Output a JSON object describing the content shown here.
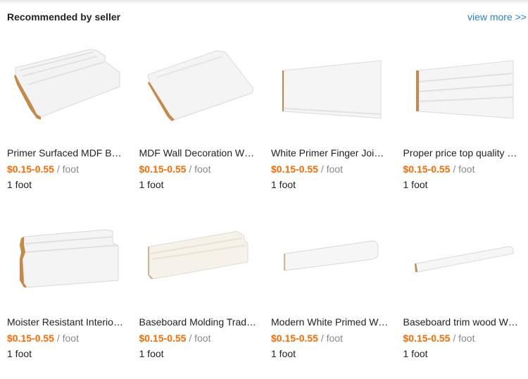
{
  "header": {
    "title": "Recommended by seller",
    "view_more": "view more >>"
  },
  "products": [
    {
      "name": "Primer Surfaced MDF Bas…",
      "price": "$0.15-0.55",
      "unit": "/ foot",
      "moq": "1 foot",
      "image": "tall-baseboard-angled"
    },
    {
      "name": "MDF Wall Decoration Whi…",
      "price": "$0.15-0.55",
      "unit": "/ foot",
      "moq": "1 foot",
      "image": "wide-board-angled"
    },
    {
      "name": "White Primer Finger Joint …",
      "price": "$0.15-0.55",
      "unit": "/ foot",
      "moq": "1 foot",
      "image": "flat-board-front"
    },
    {
      "name": "Proper price top quality w…",
      "price": "$0.15-0.55",
      "unit": "/ foot",
      "moq": "1 foot",
      "image": "grooved-board-front"
    },
    {
      "name": "Moister Resistant Interior …",
      "price": "$0.15-0.55",
      "unit": "/ foot",
      "moq": "1 foot",
      "image": "colonial-baseboard"
    },
    {
      "name": "Baseboard Molding Tradit…",
      "price": "$0.15-0.55",
      "unit": "/ foot",
      "moq": "1 foot",
      "image": "traditional-baseboard"
    },
    {
      "name": "Modern White Primed Wo…",
      "price": "$0.15-0.55",
      "unit": "/ foot",
      "moq": "1 foot",
      "image": "rounded-short-board"
    },
    {
      "name": "Baseboard trim wood Whi…",
      "price": "$0.15-0.55",
      "unit": "/ foot",
      "moq": "1 foot",
      "image": "thin-trim-board"
    }
  ]
}
